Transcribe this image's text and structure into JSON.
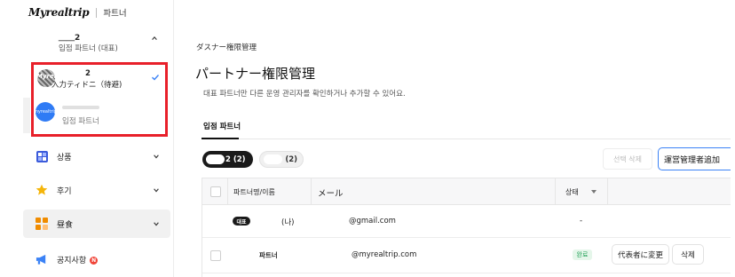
{
  "brand": {
    "logo": "Myrealtrip",
    "sub": "파트너"
  },
  "account": {
    "name": "＿＿2",
    "role": "입점 파트너 (대표)"
  },
  "dropdown": {
    "items": [
      {
        "avatar_text": "Myreal",
        "name": "2",
        "role": "入力ティドニ（待避)",
        "selected": true
      },
      {
        "avatar_text": "myrealtrip",
        "role": "입점 파트너",
        "selected": false
      }
    ]
  },
  "sidebar": {
    "items": [
      {
        "label": "상품",
        "icon": "grid-icon"
      },
      {
        "label": "후기",
        "icon": "star-icon"
      },
      {
        "label": "昼食",
        "icon": "dashboard-icon",
        "active": true
      },
      {
        "label": "공지사항",
        "icon": "megaphone-icon",
        "badge": "N"
      }
    ]
  },
  "main": {
    "breadcrumb": "ダスナー権限管理",
    "title": "パートナー権限管理",
    "description": "대표 파트너만 다른 운영 관리자를 확인하거나 추가할 수 있어요.",
    "tab": "입점 파트너",
    "filters": [
      {
        "label": "2 (2)",
        "active": true
      },
      {
        "label": "(2)",
        "active": false
      }
    ],
    "delete_selected": "선택 삭제",
    "add_manager": "運営管理者追加"
  },
  "table": {
    "headers": {
      "name": "파트너명/이름",
      "email": "メール",
      "status": "상태"
    },
    "rows": [
      {
        "badge": "대표",
        "name": "(나)",
        "email": "@gmail.com",
        "status": "-"
      },
      {
        "name": "파트너",
        "email": "@myrealtrip.com",
        "status": "완료",
        "action1": "代表者に変更",
        "action2": "삭제"
      }
    ]
  },
  "colors": {
    "highlight": "#e8202a",
    "accent": "#3b82f6",
    "done_green": "#25a35a"
  }
}
